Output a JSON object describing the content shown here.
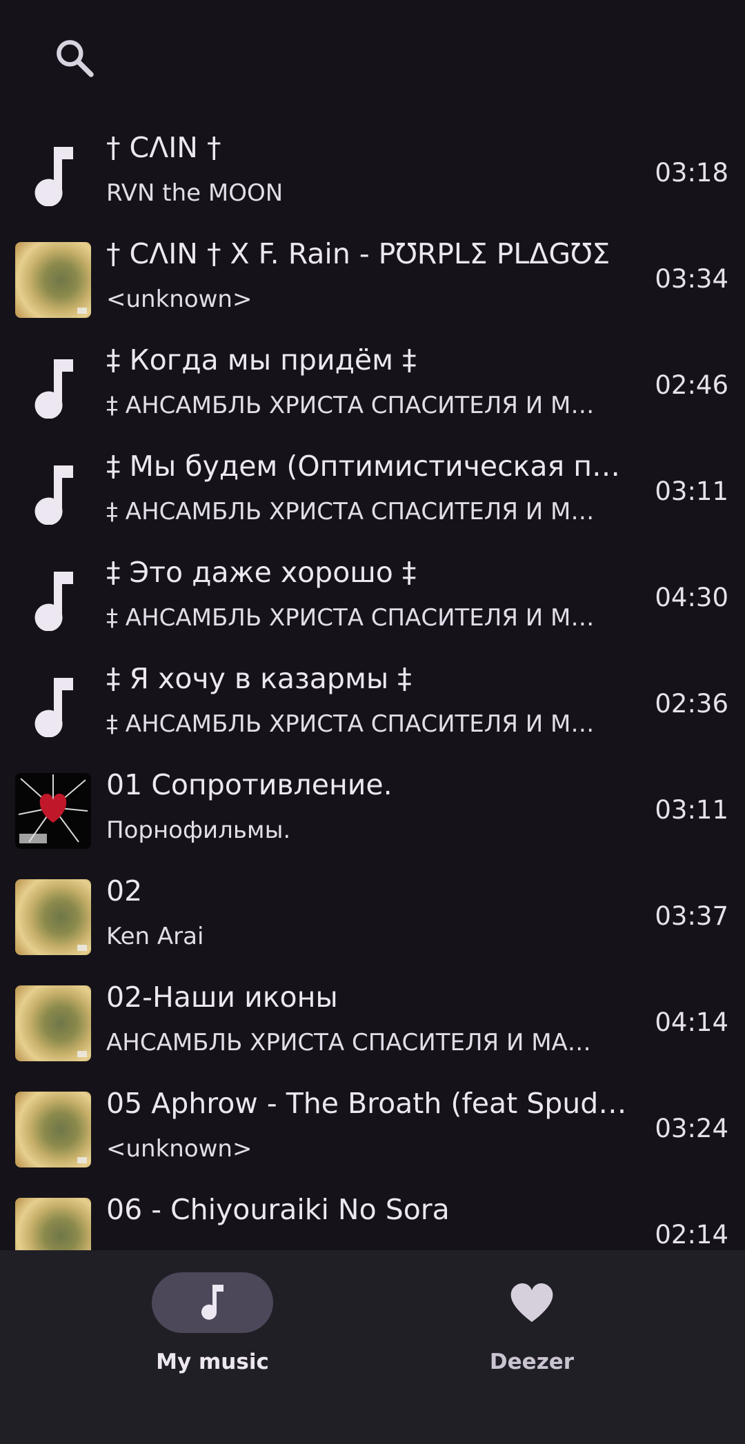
{
  "header": {
    "search_icon": "search-icon"
  },
  "tracks": [
    {
      "title": "† CΛIN †",
      "artist": "RVN the MOON",
      "duration": "03:18",
      "art": "music-note-icon"
    },
    {
      "title": "† CΛIN † X F. Rain - PƱRPLΣ PLΔGƱΣ",
      "artist": "<unknown>",
      "duration": "03:34",
      "art": "album-art"
    },
    {
      "title": "‡ Когда мы придём ‡",
      "artist": "‡ АНСАМБЛЬ ХРИСТА СПАСИТЕЛЯ И М…",
      "duration": "02:46",
      "art": "music-note-icon"
    },
    {
      "title": "‡ Мы будем (Оптимистическая пе…",
      "artist": "‡ АНСАМБЛЬ ХРИСТА СПАСИТЕЛЯ И М…",
      "duration": "03:11",
      "art": "music-note-icon"
    },
    {
      "title": "‡ Это даже хорошо ‡",
      "artist": "‡ АНСАМБЛЬ ХРИСТА СПАСИТЕЛЯ И М…",
      "duration": "04:30",
      "art": "music-note-icon"
    },
    {
      "title": "‡ Я хочу в казармы ‡",
      "artist": "‡ АНСАМБЛЬ ХРИСТА СПАСИТЕЛЯ И М…",
      "duration": "02:36",
      "art": "music-note-icon"
    },
    {
      "title": "01 Сопротивление.",
      "artist": "Порнофильмы.",
      "duration": "03:11",
      "art": "album-art-heart"
    },
    {
      "title": "02",
      "artist": "Ken Arai",
      "duration": "03:37",
      "art": "album-art"
    },
    {
      "title": "02-Наши иконы",
      "artist": "АНСАМБЛЬ ХРИСТА СПАСИТЕЛЯ И МА…",
      "duration": "04:14",
      "art": "album-art"
    },
    {
      "title": "05 Aphrow - The Broath (feat SpudS…",
      "artist": "<unknown>",
      "duration": "03:24",
      "art": "album-art"
    },
    {
      "title": "06 - Chiyouraiki No Sora",
      "artist": "",
      "duration": "02:14",
      "art": "album-art"
    }
  ],
  "nav": {
    "my_music": {
      "label": "My music",
      "icon": "music-note-icon"
    },
    "deezer": {
      "label": "Deezer",
      "icon": "heart-icon"
    }
  },
  "colors": {
    "background": "#151319",
    "nav_background": "#201f26",
    "active_pill": "#4c4759",
    "text": "#ece7f1"
  }
}
